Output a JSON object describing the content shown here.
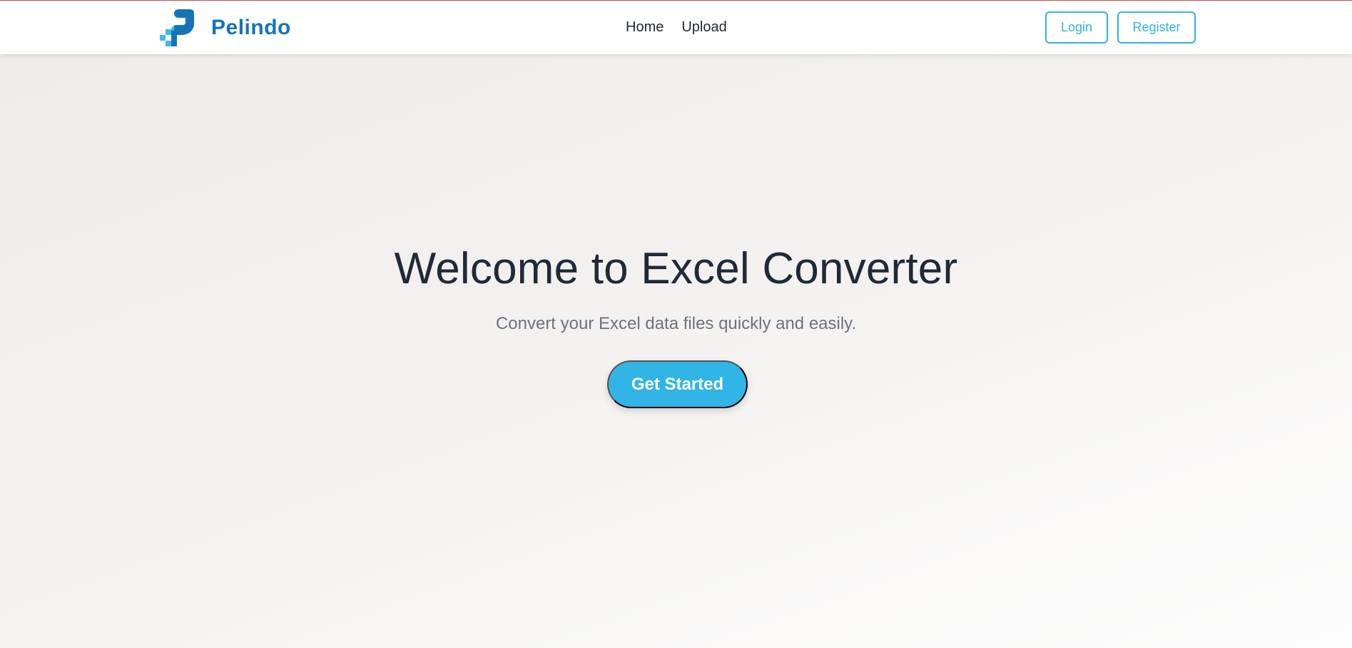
{
  "navbar": {
    "brand_name": "Pelindo",
    "brand_icon": "pelindo-logo",
    "brand_color": "#1574b8",
    "links": [
      {
        "label": "Home"
      },
      {
        "label": "Upload"
      }
    ],
    "login_label": "Login",
    "register_label": "Register",
    "accent_color": "#2fb3e5"
  },
  "hero": {
    "title": "Welcome to Excel Converter",
    "subtitle": "Convert your Excel data files quickly and easily.",
    "cta_label": "Get Started",
    "cta_color": "#31b5e7"
  }
}
